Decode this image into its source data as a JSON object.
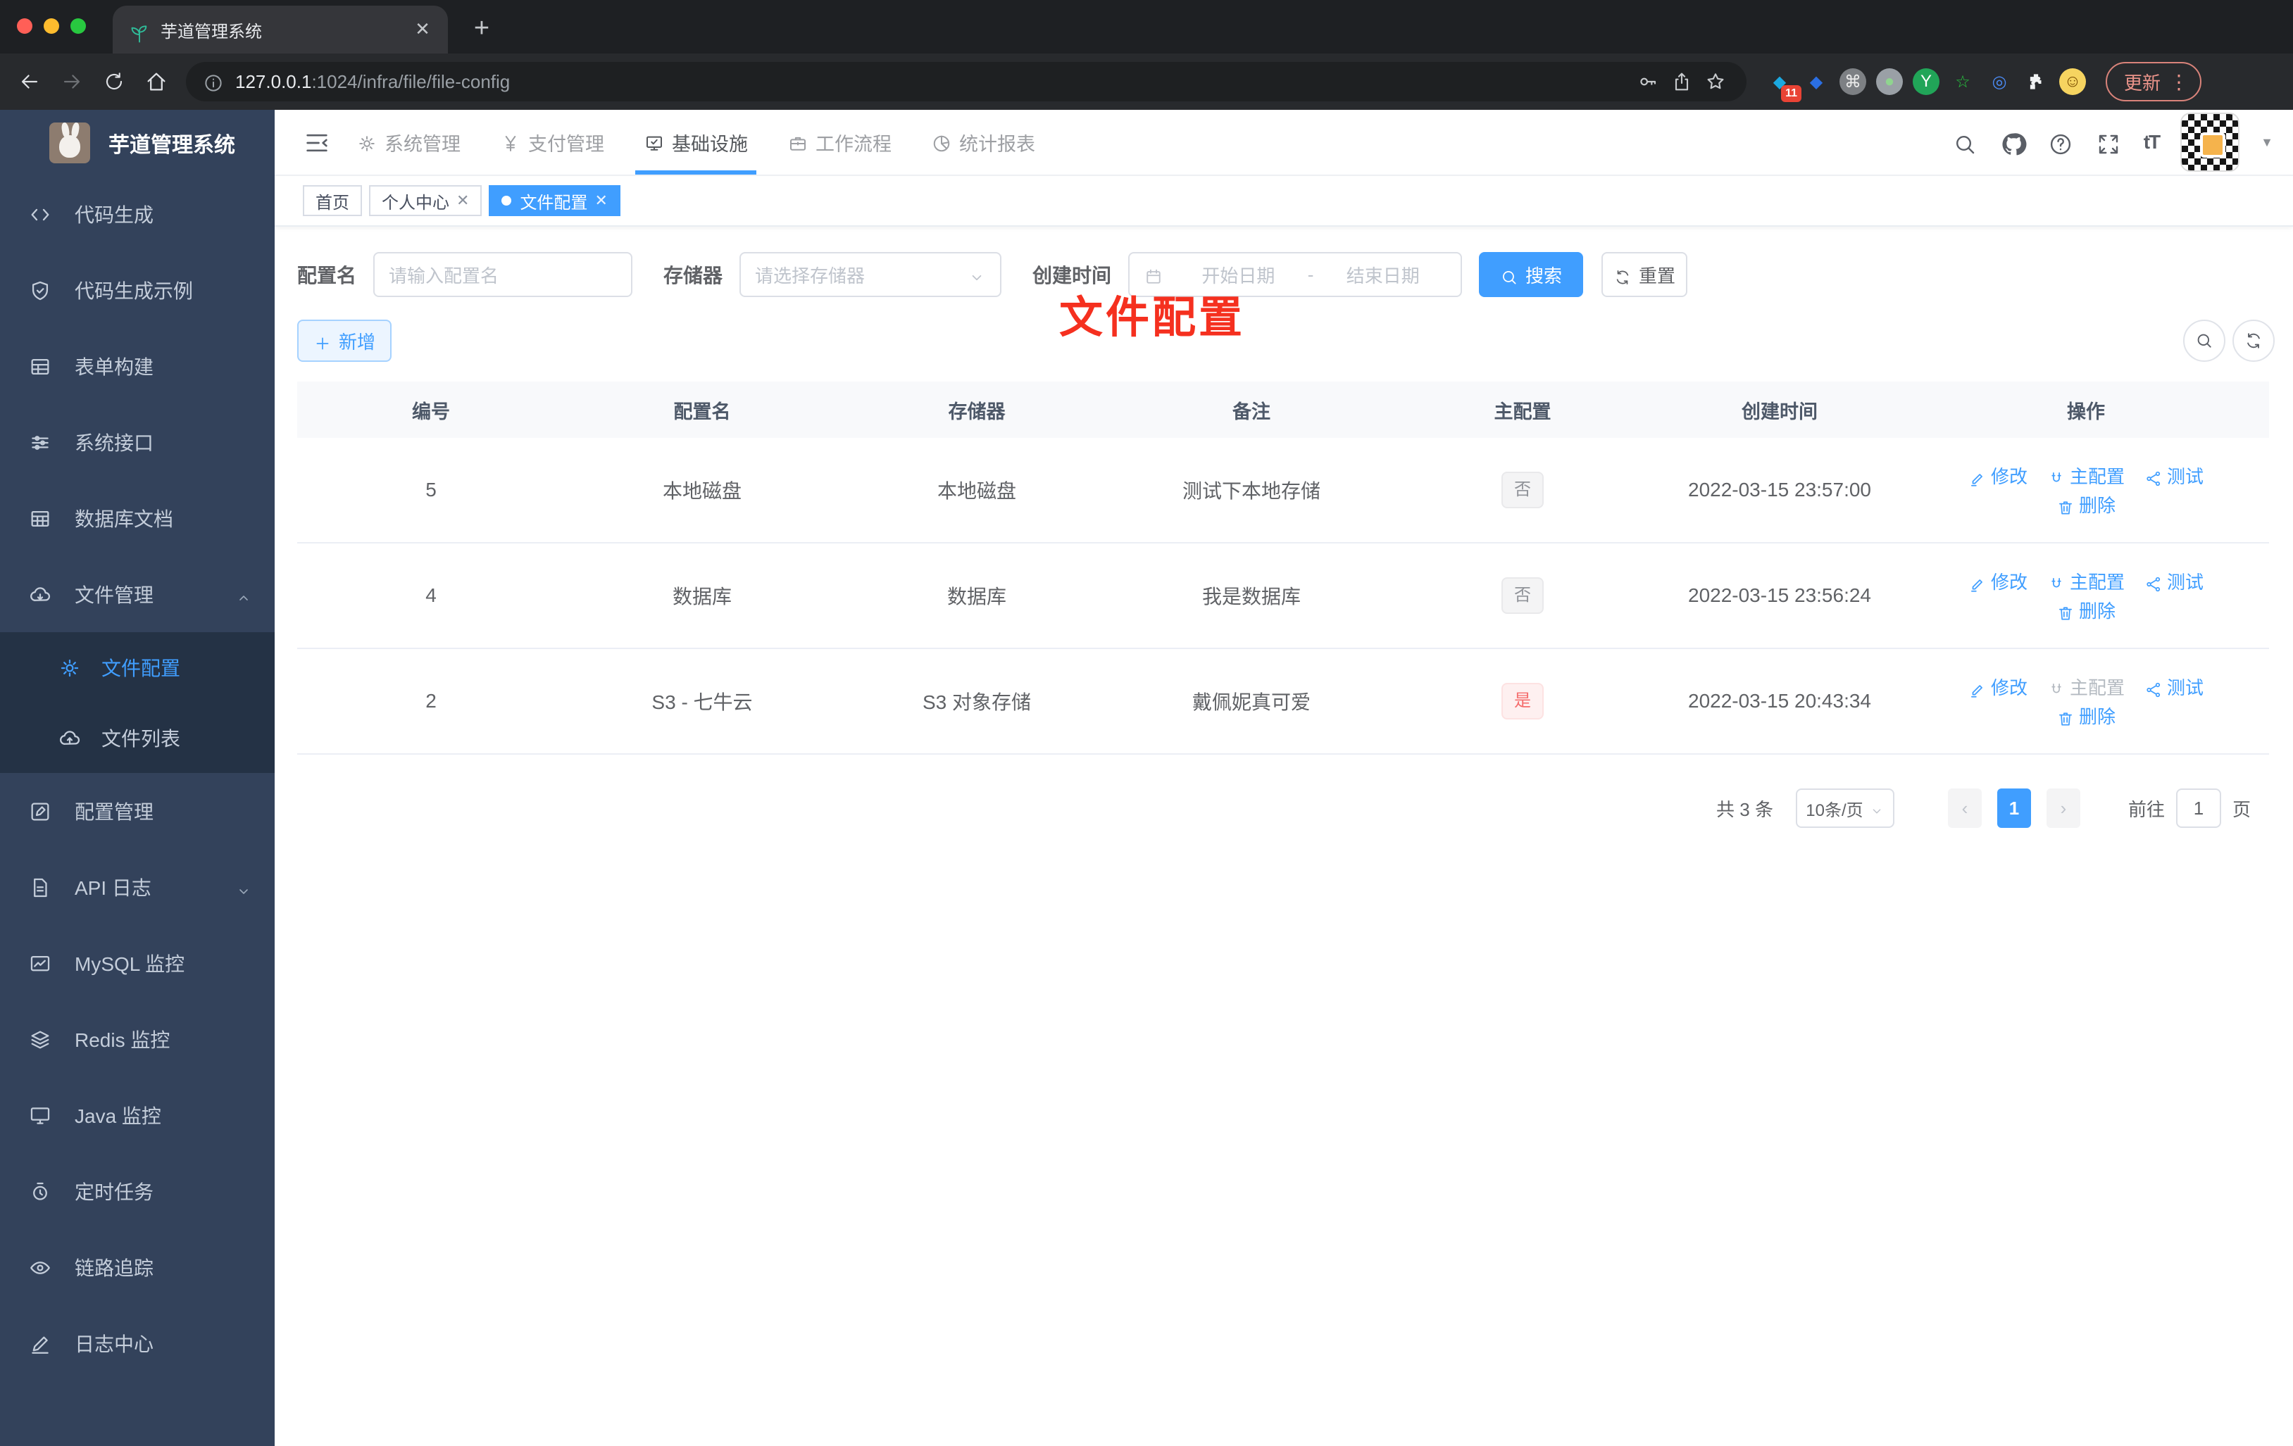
{
  "browser": {
    "tab_title": "芋道管理系统",
    "url_host": "127.0.0.1",
    "url_path": ":1024/infra/file/file-config",
    "update_label": "更新",
    "extensions": [
      {
        "name": "pinned-extension-icon",
        "glyph": "◆",
        "fg": "#1ba8e0",
        "bg": "transparent",
        "badge": "11"
      },
      {
        "name": "balloon-extension-icon",
        "glyph": "◆",
        "fg": "#2b6fe3",
        "bg": "transparent"
      },
      {
        "name": "command-extension-icon",
        "glyph": "⌘",
        "fg": "#ececec",
        "bg": "#7d8084"
      },
      {
        "name": "recorder-extension-icon",
        "glyph": "●",
        "fg": "#8fd48f",
        "bg": "#9aa0a6"
      },
      {
        "name": "y-extension-icon",
        "glyph": "Y",
        "fg": "#ffffff",
        "bg": "#21a558"
      },
      {
        "name": "star-extension-icon",
        "glyph": "☆",
        "fg": "#27c93f",
        "bg": "transparent"
      },
      {
        "name": "eye-extension-icon",
        "glyph": "◎",
        "fg": "#4b8bf5",
        "bg": "transparent"
      },
      {
        "name": "puzzle-extension-icon",
        "glyph": "",
        "fg": "#f1f3f4",
        "bg": "transparent"
      },
      {
        "name": "profile-avatar",
        "glyph": "☺",
        "fg": "#7a4d00",
        "bg": "#f6d460"
      }
    ]
  },
  "overlay": {
    "page_title": "文件配置"
  },
  "sidebar": {
    "logo_title": "芋道管理系统",
    "items": [
      {
        "label": "代码生成",
        "icon": "code-icon"
      },
      {
        "label": "代码生成示例",
        "icon": "shield-check-icon"
      },
      {
        "label": "表单构建",
        "icon": "form-grid-icon"
      },
      {
        "label": "系统接口",
        "icon": "sliders-icon"
      },
      {
        "label": "数据库文档",
        "icon": "table-icon"
      },
      {
        "label": "文件管理",
        "icon": "cloud-download-icon",
        "caret": "up"
      },
      {
        "label": "文件配置",
        "icon": "gear-icon",
        "child": true,
        "active": true
      },
      {
        "label": "文件列表",
        "icon": "cloud-upload-icon",
        "child": true
      },
      {
        "label": "配置管理",
        "icon": "edit-square-icon"
      },
      {
        "label": "API 日志",
        "icon": "doc-edit-icon",
        "caret": "down"
      },
      {
        "label": "MySQL 监控",
        "icon": "chart-icon"
      },
      {
        "label": "Redis 监控",
        "icon": "layers-icon"
      },
      {
        "label": "Java 监控",
        "icon": "monitor-icon"
      },
      {
        "label": "定时任务",
        "icon": "timer-icon"
      },
      {
        "label": "链路追踪",
        "icon": "eye-icon"
      },
      {
        "label": "日志中心",
        "icon": "pen-icon"
      }
    ]
  },
  "nav": {
    "tabs": [
      {
        "label": "系统管理",
        "icon": "gear-icon"
      },
      {
        "label": "支付管理",
        "icon": "yen-icon"
      },
      {
        "label": "基础设施",
        "icon": "infra-icon",
        "active": true
      },
      {
        "label": "工作流程",
        "icon": "briefcase-icon"
      },
      {
        "label": "统计报表",
        "icon": "report-icon"
      }
    ]
  },
  "tags": [
    {
      "label": "首页"
    },
    {
      "label": "个人中心",
      "closable": true
    },
    {
      "label": "文件配置",
      "closable": true,
      "active": true
    }
  ],
  "filters": {
    "name_label": "配置名",
    "name_placeholder": "请输入配置名",
    "storage_label": "存储器",
    "storage_placeholder": "请选择存储器",
    "date_label": "创建时间",
    "date_start_placeholder": "开始日期",
    "date_separator": "-",
    "date_end_placeholder": "结束日期",
    "search_label": "搜索",
    "reset_label": "重置"
  },
  "toolbar": {
    "add_label": "新增"
  },
  "table": {
    "columns": [
      "编号",
      "配置名",
      "存储器",
      "备注",
      "主配置",
      "创建时间",
      "操作"
    ],
    "action_labels": {
      "edit": "修改",
      "master": "主配置",
      "test": "测试",
      "delete": "删除"
    },
    "rows": [
      {
        "id": "5",
        "name": "本地磁盘",
        "storage": "本地磁盘",
        "remark": "测试下本地存储",
        "master": "否",
        "master_type": "info",
        "created": "2022-03-15 23:57:00",
        "master_action_disabled": false
      },
      {
        "id": "4",
        "name": "数据库",
        "storage": "数据库",
        "remark": "我是数据库",
        "master": "否",
        "master_type": "info",
        "created": "2022-03-15 23:56:24",
        "master_action_disabled": false
      },
      {
        "id": "2",
        "name": "S3 - 七牛云",
        "storage": "S3 对象存储",
        "remark": "戴佩妮真可爱",
        "master": "是",
        "master_type": "danger",
        "created": "2022-03-15 20:43:34",
        "master_action_disabled": true
      }
    ]
  },
  "pagination": {
    "total": "共 3 条",
    "page_size": "10条/页",
    "current_page": "1",
    "goto_label": "前往",
    "goto_value": "1",
    "page_unit": "页"
  },
  "colors": {
    "primary": "#409eff",
    "danger_text": "#f56c6c",
    "overlay_red": "#f5301f",
    "sidebar_bg": "#33425b",
    "submenu_bg": "#243245"
  }
}
